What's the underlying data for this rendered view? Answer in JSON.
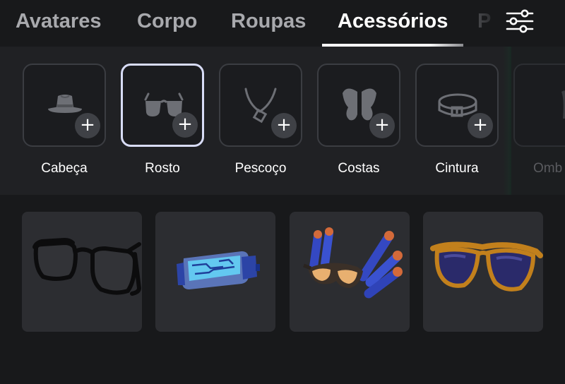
{
  "tabs": [
    {
      "label": "Avatares",
      "active": false
    },
    {
      "label": "Corpo",
      "active": false
    },
    {
      "label": "Roupas",
      "active": false
    },
    {
      "label": "Acessórios",
      "active": true
    },
    {
      "label": "P",
      "active": false
    }
  ],
  "filter": {
    "icon": "sliders-icon"
  },
  "categories": [
    {
      "label": "Cabeça",
      "icon": "hat-icon",
      "selected": false
    },
    {
      "label": "Rosto",
      "icon": "glasses-icon",
      "selected": true
    },
    {
      "label": "Pescoço",
      "icon": "necklace-icon",
      "selected": false
    },
    {
      "label": "Costas",
      "icon": "wings-icon",
      "selected": false
    },
    {
      "label": "Cintura",
      "icon": "belt-icon",
      "selected": false
    },
    {
      "label": "Omb",
      "icon": "shoulder-icon",
      "selected": false
    }
  ],
  "items": [
    {
      "thumbnail": "black-frame-glasses"
    },
    {
      "thumbnail": "blue-tech-visor"
    },
    {
      "thumbnail": "blue-dart-goggles"
    },
    {
      "thumbnail": "orange-aviator-sunglasses"
    }
  ],
  "colors": {
    "background": "#18191b",
    "strip": "#202124",
    "tile_border": "#3b3d42",
    "selected_border": "#d8dcf6",
    "card": "#2c2d31"
  }
}
